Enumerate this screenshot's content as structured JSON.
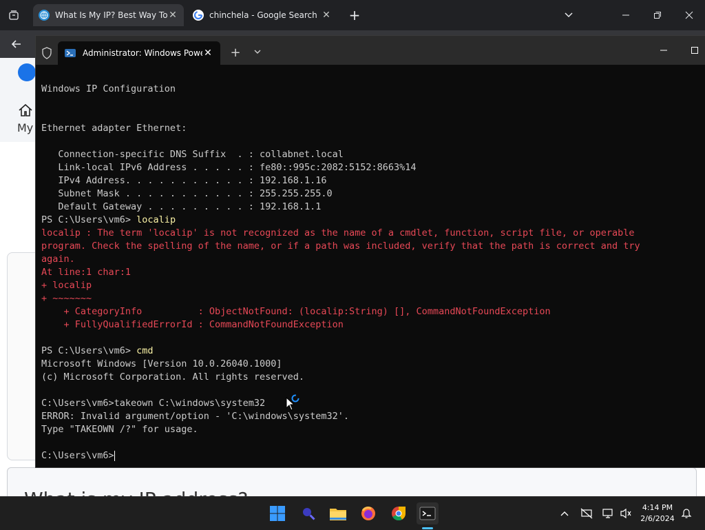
{
  "browser": {
    "tabs": [
      {
        "title": "What Is My IP? Best Way To Ch",
        "active": true
      },
      {
        "title": "chinchela - Google Search",
        "active": false
      }
    ],
    "new_tab_symbol": "+",
    "page": {
      "nav_label": "My",
      "heading_fragment": "What is my IP address?"
    }
  },
  "terminal": {
    "tab_title": "Administrator: Windows Powe",
    "new_tab_symbol": "+",
    "lines": [
      {
        "text": "Windows IP Configuration",
        "type": "normal"
      },
      {
        "text": "Ethernet adapter Ethernet:",
        "type": "normal"
      },
      {
        "text": "   Connection-specific DNS Suffix  . : collabnet.local",
        "type": "normal"
      },
      {
        "text": "   Link-local IPv6 Address . . . . . : fe80::995c:2082:5152:8663%14",
        "type": "normal"
      },
      {
        "text": "   IPv4 Address. . . . . . . . . . . : 192.168.1.16",
        "type": "normal"
      },
      {
        "text": "   Subnet Mask . . . . . . . . . . . : 255.255.255.0",
        "type": "normal"
      },
      {
        "text": "   Default Gateway . . . . . . . . . : 192.168.1.1",
        "type": "normal"
      },
      {
        "prompt": "PS C:\\Users\\vm6> ",
        "cmd": "localip",
        "type": "prompt"
      },
      {
        "text": "localip : The term 'localip' is not recognized as the name of a cmdlet, function, script file, or operable",
        "type": "error"
      },
      {
        "text": "program. Check the spelling of the name, or if a path was included, verify that the path is correct and try",
        "type": "error"
      },
      {
        "text": "again.",
        "type": "error"
      },
      {
        "text": "At line:1 char:1",
        "type": "error"
      },
      {
        "text": "+ localip",
        "type": "error"
      },
      {
        "text": "+ ~~~~~~~",
        "type": "error"
      },
      {
        "text": "    + CategoryInfo          : ObjectNotFound: (localip:String) [], CommandNotFoundException",
        "type": "error"
      },
      {
        "text": "    + FullyQualifiedErrorId : CommandNotFoundException",
        "type": "error"
      },
      {
        "prompt": "PS C:\\Users\\vm6> ",
        "cmd": "cmd",
        "type": "prompt"
      },
      {
        "text": "Microsoft Windows [Version 10.0.26040.1000]",
        "type": "normal"
      },
      {
        "text": "(c) Microsoft Corporation. All rights reserved.",
        "type": "normal"
      },
      {
        "text": "C:\\Users\\vm6>takeown C:\\windows\\system32",
        "type": "normal"
      },
      {
        "text": "ERROR: Invalid argument/option - 'C:\\windows\\system32'.",
        "type": "normal"
      },
      {
        "text": "Type \"TAKEOWN /?\" for usage.",
        "type": "normal"
      },
      {
        "text": "C:\\Users\\vm6>",
        "type": "normal"
      }
    ]
  },
  "taskbar": {
    "time": "4:14 PM",
    "date": "2/6/2024"
  },
  "colors": {
    "terminal_bg": "#0c0c0c",
    "terminal_text": "#cccccc",
    "error_text": "#e74856",
    "command_text": "#f9f1a5",
    "taskbar_bg": "#1f1f1f"
  }
}
